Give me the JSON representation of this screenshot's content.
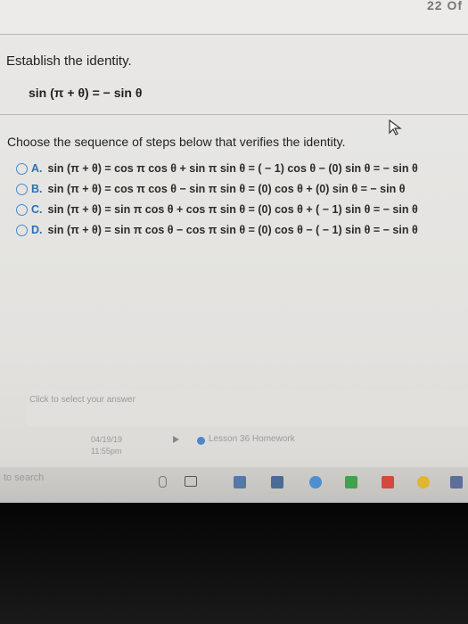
{
  "topbar": {
    "number": "22 Of"
  },
  "question": {
    "title": "Establish the identity.",
    "identity": "sin (π + θ) = − sin θ",
    "instruction": "Choose the sequence of steps below that verifies the identity."
  },
  "choices": [
    {
      "letter": "A.",
      "text": "sin (π + θ) = cos π cos θ + sin π sin θ = ( − 1) cos θ − (0) sin θ = − sin θ"
    },
    {
      "letter": "B.",
      "text": "sin (π + θ) = cos π cos θ − sin π sin θ = (0) cos θ + (0) sin θ = − sin θ"
    },
    {
      "letter": "C.",
      "text": "sin (π + θ) = sin π cos θ + cos π sin θ = (0) cos θ + ( − 1) sin θ = − sin θ"
    },
    {
      "letter": "D.",
      "text": "sin (π + θ) = sin π cos θ − cos π sin θ = (0) cos θ − ( − 1) sin θ = − sin θ"
    }
  ],
  "answer_prompt": "Click to select your answer",
  "footer": {
    "date": "04/19/19",
    "time": "11:55pm",
    "lesson": "Lesson 36 Homework"
  },
  "taskbar": {
    "search_text": "to search"
  },
  "colors": {
    "accent": "#4b8ac9",
    "text": "#222222"
  }
}
